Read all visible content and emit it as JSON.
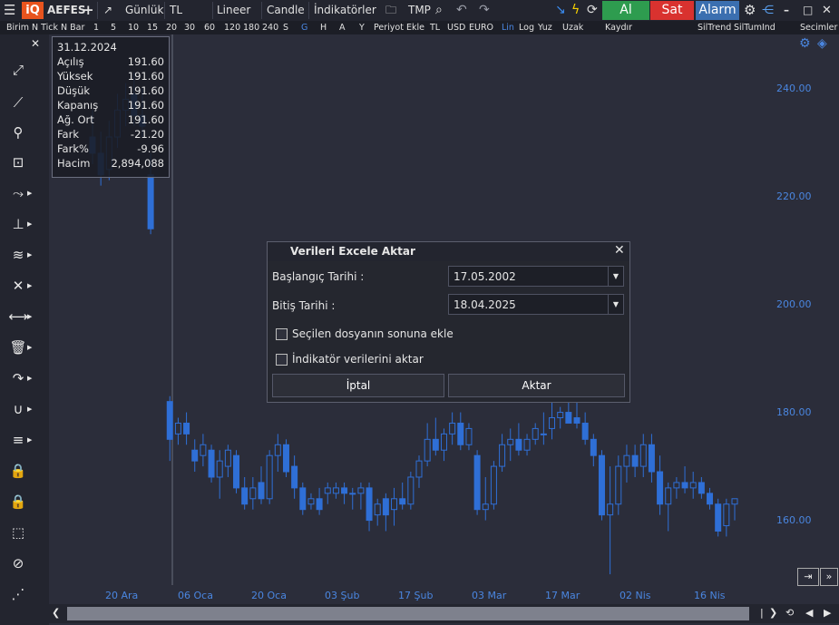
{
  "toolbar": {
    "logo": "iQ",
    "symbol": "AEFES",
    "period": "Günlük",
    "currency": "TL",
    "scale": "Lineer",
    "chart_type": "Candle",
    "indicators": "İndikatörler",
    "tmp": "TMP",
    "buy": "Al",
    "sell": "Sat",
    "alarm": "Alarm",
    "accent_buy": "#2e9c4f",
    "accent_sell": "#d9322f",
    "accent_alarm": "#3b6fb0"
  },
  "bar2": {
    "items": [
      "Birim",
      "N Tick",
      "N Bar",
      "1",
      "5",
      "10",
      "15",
      "20",
      "30",
      "60",
      "120",
      "180",
      "240",
      "S",
      "G",
      "H",
      "A",
      "Y",
      "Periyot Ekle",
      "TL",
      "USD",
      "EURO",
      "Lin",
      "Log",
      "Yuz",
      "Uzak",
      "Kaydır",
      "SilTrend",
      "SilTumInd"
    ],
    "selections": "Secimler"
  },
  "infobox": {
    "date": "31.12.2024",
    "rows": [
      {
        "k": "Açılış",
        "v": "191.60"
      },
      {
        "k": "Yüksek",
        "v": "191.60"
      },
      {
        "k": "Düşük",
        "v": "191.60"
      },
      {
        "k": "Kapanış",
        "v": "191.60"
      },
      {
        "k": "Ağ. Ort",
        "v": "191.60"
      },
      {
        "k": "Fark",
        "v": "-21.20"
      },
      {
        "k": "Fark%",
        "v": "-9.96"
      },
      {
        "k": "Hacim",
        "v": "2,894,088"
      }
    ]
  },
  "dialog": {
    "title": "Verileri Excele Aktar",
    "start_label": "Başlangıç Tarihi :",
    "start_value": "17.05.2002",
    "end_label": "Bitiş Tarihi :",
    "end_value": "18.04.2025",
    "append_label": "Seçilen dosyanın sonuna ekle",
    "indicator_label": "İndikatör verilerini aktar",
    "cancel": "İptal",
    "export": "Aktar"
  },
  "chart_data": {
    "type": "candlestick",
    "color": "#2f6fd6",
    "y_ticks": [
      240.0,
      220.0,
      200.0,
      180.0,
      160.0
    ],
    "ylim": [
      148,
      250
    ],
    "x_ticks": [
      "20 Ara",
      "06 Oca",
      "20 Oca",
      "03 Şub",
      "17 Şub",
      "03 Mar",
      "17 Mar",
      "02 Nis",
      "16 Nis"
    ],
    "candles": [
      [
        231,
        236,
        226,
        228
      ],
      [
        228,
        232,
        222,
        224
      ],
      [
        225,
        234,
        223,
        231
      ],
      [
        231,
        239,
        229,
        236
      ],
      [
        236,
        241,
        233,
        238
      ],
      [
        239,
        243,
        233,
        235
      ],
      [
        235,
        240,
        231,
        233
      ],
      [
        224,
        228,
        213,
        214
      ],
      [
        182,
        183,
        171,
        175
      ],
      [
        176,
        179,
        174,
        178
      ],
      [
        178,
        180,
        174,
        176
      ],
      [
        173,
        175,
        169,
        171
      ],
      [
        172,
        176,
        170,
        174
      ],
      [
        173,
        174,
        167,
        168
      ],
      [
        168,
        173,
        164,
        171
      ],
      [
        170,
        174,
        168,
        173
      ],
      [
        172,
        173,
        165,
        166
      ],
      [
        166,
        168,
        162,
        163
      ],
      [
        164,
        168,
        162,
        166
      ],
      [
        167,
        170,
        163,
        164
      ],
      [
        164,
        173,
        163,
        172
      ],
      [
        172,
        176,
        169,
        174
      ],
      [
        174,
        175,
        168,
        169
      ],
      [
        170,
        172,
        164,
        166
      ],
      [
        166,
        167,
        161,
        162
      ],
      [
        163,
        165,
        162,
        164
      ],
      [
        164,
        166,
        161,
        162
      ],
      [
        165,
        167,
        163,
        166
      ],
      [
        165,
        167,
        164,
        166
      ],
      [
        166,
        167,
        163,
        165
      ],
      [
        165,
        166,
        162,
        165
      ],
      [
        165,
        167,
        162,
        166
      ],
      [
        166,
        167,
        158,
        160
      ],
      [
        161,
        164,
        159,
        163
      ],
      [
        164,
        165,
        158,
        161
      ],
      [
        162,
        166,
        159,
        164
      ],
      [
        164,
        167,
        162,
        163
      ],
      [
        163,
        169,
        162,
        168
      ],
      [
        168,
        172,
        166,
        171
      ],
      [
        171,
        178,
        170,
        175
      ],
      [
        175,
        179,
        172,
        173
      ],
      [
        173,
        177,
        171,
        176
      ],
      [
        176,
        180,
        174,
        178
      ],
      [
        178,
        180,
        173,
        174
      ],
      [
        174,
        178,
        173,
        177
      ],
      [
        172,
        173,
        161,
        162
      ],
      [
        162,
        168,
        160,
        163
      ],
      [
        163,
        171,
        162,
        170
      ],
      [
        170,
        176,
        169,
        174
      ],
      [
        174,
        177,
        171,
        175
      ],
      [
        175,
        178,
        172,
        173
      ],
      [
        173,
        176,
        172,
        175
      ],
      [
        175,
        178,
        174,
        177
      ],
      [
        176,
        180,
        174,
        176
      ],
      [
        177,
        182,
        175,
        179
      ],
      [
        179,
        181,
        177,
        180
      ],
      [
        180,
        186,
        178,
        178
      ],
      [
        179,
        185,
        177,
        178
      ],
      [
        178,
        180,
        174,
        175
      ],
      [
        175,
        176,
        170,
        172
      ],
      [
        172,
        173,
        160,
        161
      ],
      [
        161,
        170,
        150,
        163
      ],
      [
        163,
        172,
        161,
        170
      ],
      [
        170,
        174,
        167,
        172
      ],
      [
        172,
        174,
        168,
        170
      ],
      [
        170,
        176,
        168,
        174
      ],
      [
        174,
        176,
        167,
        169
      ],
      [
        169,
        172,
        161,
        163
      ],
      [
        163,
        167,
        158,
        166
      ],
      [
        166,
        168,
        164,
        167
      ],
      [
        167,
        170,
        165,
        166
      ],
      [
        166,
        169,
        164,
        167
      ],
      [
        167,
        168,
        164,
        165
      ],
      [
        165,
        166,
        162,
        163
      ],
      [
        163,
        164,
        157,
        158
      ],
      [
        159,
        164,
        157,
        163
      ],
      [
        163,
        164,
        160,
        164
      ]
    ]
  }
}
